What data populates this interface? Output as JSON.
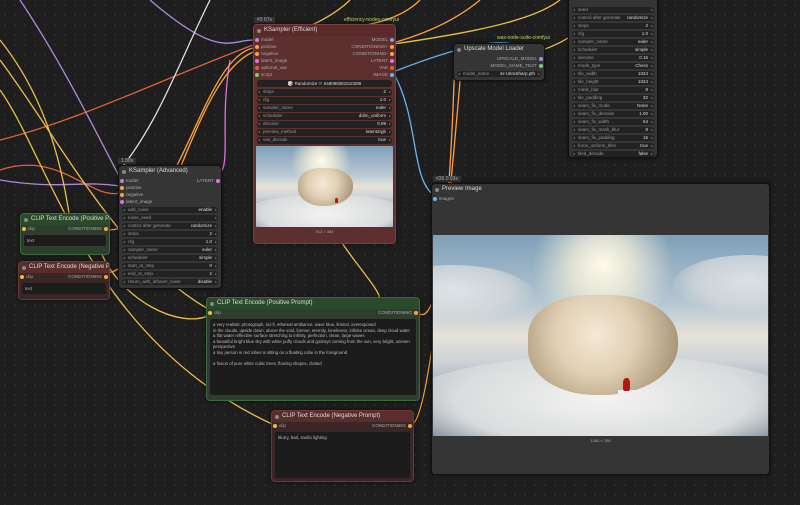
{
  "top_labels": {
    "efficiency": "efficiency-nodes-comfyui",
    "was": "was-node-suite-comfyui",
    "ks_eff_id": "#3 67s",
    "ks_adv_id": "1.88s",
    "preview_id": "#26 0.93s"
  },
  "ksampler_eff": {
    "title": "KSampler (Efficient)",
    "inputs": [
      "model",
      "positive",
      "negative",
      "latent_image",
      "optional_vae",
      "script"
    ],
    "outputs": [
      "MODEL",
      "CONDITIONING+",
      "CONDITIONING-",
      "LATENT",
      "VAE",
      "IMAGE"
    ],
    "seed_label": "Randomize",
    "seed_value": "648098361510286",
    "widgets": [
      {
        "k": "steps",
        "v": "2"
      },
      {
        "k": "cfg",
        "v": "1.0"
      },
      {
        "k": "sampler_name",
        "v": "euler"
      },
      {
        "k": "scheduler",
        "v": "ddim_uniform"
      },
      {
        "k": "denoise",
        "v": "0.99"
      },
      {
        "k": "preview_method",
        "v": "latent2rgb"
      },
      {
        "k": "vae_decode",
        "v": "true"
      }
    ],
    "caption": "512 × 384"
  },
  "ksampler_adv": {
    "title": "KSampler (Advanced)",
    "inputs": [
      "model",
      "positive",
      "negative",
      "latent_image"
    ],
    "output": "LATENT",
    "widgets": [
      {
        "k": "add_noise",
        "v": "enable"
      },
      {
        "k": "noise_seed",
        "v": ""
      },
      {
        "k": "control after generate",
        "v": "randomize"
      },
      {
        "k": "steps",
        "v": "2"
      },
      {
        "k": "cfg",
        "v": "1.0"
      },
      {
        "k": "sampler_name",
        "v": "euler"
      },
      {
        "k": "scheduler",
        "v": "simple"
      },
      {
        "k": "start_at_step",
        "v": "0"
      },
      {
        "k": "end_at_step",
        "v": "2"
      },
      {
        "k": "return_with_leftover_noise",
        "v": "disable"
      }
    ]
  },
  "upscale_loader": {
    "title": "Upscale Model Loader",
    "out1": "UPSCALE_MODEL",
    "out2": "MODEL_NAME_TEXT",
    "widget_k": "model_name",
    "widget_v": "4x-UltraSharp.pth"
  },
  "right_panel": {
    "widgets": [
      {
        "k": "seed",
        "v": ""
      },
      {
        "k": "control after generate",
        "v": "randomize"
      },
      {
        "k": "steps",
        "v": "2"
      },
      {
        "k": "cfg",
        "v": "1.0"
      },
      {
        "k": "sampler_name",
        "v": "euler"
      },
      {
        "k": "scheduler",
        "v": "simple"
      },
      {
        "k": "denoise",
        "v": "0.15"
      },
      {
        "k": "mode_type",
        "v": "Chess"
      },
      {
        "k": "tile_width",
        "v": "1024"
      },
      {
        "k": "tile_height",
        "v": "1024"
      },
      {
        "k": "mask_blur",
        "v": "8"
      },
      {
        "k": "tile_padding",
        "v": "32"
      },
      {
        "k": "seam_fix_mode",
        "v": "None"
      },
      {
        "k": "seam_fix_denoise",
        "v": "1.00"
      },
      {
        "k": "seam_fix_width",
        "v": "64"
      },
      {
        "k": "seam_fix_mask_blur",
        "v": "8"
      },
      {
        "k": "seam_fix_padding",
        "v": "16"
      },
      {
        "k": "force_uniform_tiles",
        "v": "true"
      },
      {
        "k": "tiled_decode",
        "v": "false"
      }
    ]
  },
  "clip_pos_small": {
    "title": "CLIP Text Encode (Positive Pr...",
    "in": "clip",
    "out": "CONDITIONING",
    "text": "text"
  },
  "clip_neg_small": {
    "title": "CLIP Text Encode (Negative Pr...",
    "in": "clip",
    "out": "CONDITIONING",
    "text": "text"
  },
  "clip_pos": {
    "title": "CLIP Text Encode (Positive Prompt)",
    "in": "clip",
    "out": "CONDITIONING",
    "text": "a very realistic photograph, sci-fi, ethereal ambiance, wave blue, liminal, overexposed\nin the clouds, upside down, above the void, forever, eternity, loneliness, infinite ocean, deep cloud water\na flat water reflective surface stretching to infinity, perfection, clean, large waves\na beautiful bright blue sky with white puffy clouds and godrays coming from the sun, very bright, uneven perspective\na tiny person in red robes is sitting on a floating cube in the foreground\n\na fusion of pure white cubic trees, flowing shapes, clutted"
  },
  "clip_neg": {
    "title": "CLIP Text Encode (Negative Prompt)",
    "in": "clip",
    "out": "CONDITIONING",
    "text": "blurry, bad, studio lighting"
  },
  "preview": {
    "title": "Preview Image",
    "in": "images",
    "caption": "1280 × 768"
  }
}
